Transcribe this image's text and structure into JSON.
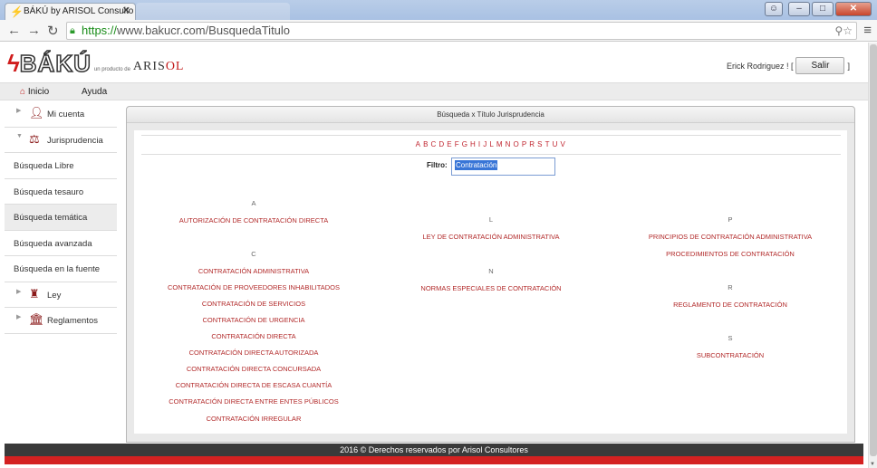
{
  "browser": {
    "tab_title": "BÁKÚ by ARISOL Consulto",
    "tab2_title": "",
    "url_scheme": "https://",
    "url_rest": "www.bakucr.com/BusquedaTitulo"
  },
  "header": {
    "logo_baku": "BÁKÚ",
    "logo_byline": "un producto de",
    "logo_arisol_1": "ARIS",
    "logo_arisol_2": "OL",
    "user_text": "Erick Rodriguez ! [",
    "user_close": "]",
    "salir": "Salir"
  },
  "topnav": {
    "inicio": "Inicio",
    "ayuda": "Ayuda"
  },
  "sidebar": [
    {
      "label": "Mi cuenta"
    },
    {
      "label": "Jurisprudencia"
    },
    {
      "label": "Búsqueda Libre"
    },
    {
      "label": "Búsqueda tesauro"
    },
    {
      "label": "Búsqueda temática"
    },
    {
      "label": "Búsqueda avanzada"
    },
    {
      "label": "Búsqueda en la fuente"
    },
    {
      "label": "Ley"
    },
    {
      "label": "Reglamentos"
    }
  ],
  "panel": {
    "title": "Búsqueda x Título Jurisprudencia",
    "alphabet": [
      "A",
      "B",
      "C",
      "D",
      "E",
      "F",
      "G",
      "H",
      "I",
      "J",
      "L",
      "M",
      "N",
      "O",
      "P",
      "R",
      "S",
      "T",
      "U",
      "V"
    ],
    "filtro_label": "Filtro:",
    "filtro_value": "Contratación"
  },
  "results": {
    "col1": {
      "A": [
        "AUTORIZACIÓN DE CONTRATACIÓN DIRECTA"
      ],
      "C": [
        "CONTRATACIÓN ADMINISTRATIVA",
        "CONTRATACIÓN DE PROVEEDORES INHABILITADOS",
        "CONTRATACIÓN DE SERVICIOS",
        "CONTRATACIÓN DE URGENCIA",
        "CONTRATACIÓN DIRECTA",
        "CONTRATACIÓN DIRECTA AUTORIZADA",
        "CONTRATACIÓN DIRECTA CONCURSADA",
        "CONTRATACIÓN DIRECTA DE ESCASA CUANTÍA",
        "CONTRATACIÓN DIRECTA ENTRE ENTES PÚBLICOS",
        "CONTRATACIÓN IRREGULAR"
      ]
    },
    "col2": {
      "L": [
        "LEY DE CONTRATACIÓN ADMINISTRATIVA"
      ],
      "N": [
        "NORMAS ESPECIALES DE CONTRATACIÓN"
      ]
    },
    "col3": {
      "P": [
        "PRINCIPIOS DE CONTRATACIÓN ADMINISTRATIVA",
        "PROCEDIMIENTOS DE CONTRATACIÓN"
      ],
      "R": [
        "REGLAMENTO DE CONTRATACIÓN"
      ],
      "S": [
        "SUBCONTRATACIÓN"
      ]
    }
  },
  "footer": {
    "text": "2016 © Derechos reservados por Arisol Consultores"
  },
  "colors": {
    "accent": "#c41e1e",
    "link": "#b22a2a",
    "footer_bg": "#3a3a3a"
  }
}
